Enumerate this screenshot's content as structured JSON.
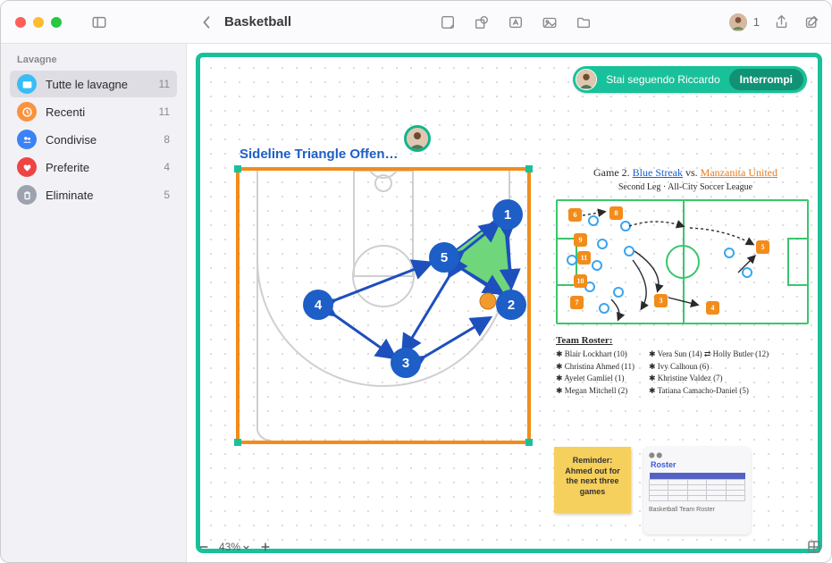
{
  "header": {
    "title": "Basketball",
    "participant_count": "1"
  },
  "sidebar": {
    "section": "Lavagne",
    "items": [
      {
        "label": "Tutte le lavagne",
        "count": "11",
        "icon": "folder",
        "sel": true
      },
      {
        "label": "Recenti",
        "count": "11",
        "icon": "clock",
        "sel": false
      },
      {
        "label": "Condivise",
        "count": "8",
        "icon": "shared",
        "sel": false
      },
      {
        "label": "Preferite",
        "count": "4",
        "icon": "heart",
        "sel": false
      },
      {
        "label": "Eliminate",
        "count": "5",
        "icon": "trash",
        "sel": false
      }
    ]
  },
  "follow_pill": {
    "text": "Stai seguendo Riccardo",
    "stop_label": "Interrompi"
  },
  "play": {
    "title": "Sideline Triangle Offen…",
    "players": [
      "1",
      "2",
      "3",
      "4",
      "5"
    ]
  },
  "game": {
    "heading_prefix": "Game 2.",
    "team1": "Blue Streak",
    "vs": "vs.",
    "team2": "Manzanita United",
    "subtitle": "Second Leg · All-City Soccer League",
    "orange_chips": [
      "6",
      "8",
      "9",
      "11",
      "10",
      "7",
      "3",
      "4",
      "5"
    ]
  },
  "roster": {
    "title": "Team Roster:",
    "left": [
      "✱ Blair Lockhart (10)",
      "✱ Christina Ahmed (11)",
      "✱ Ayelet Gamliel (1)",
      "✱ Megan Mitchell (2)"
    ],
    "right": [
      "✱ Vera Sun (14) ⇄ Holly Butler (12)",
      "✱ Ivy Calhoun (6)",
      "✱ Khristine Valdez (7)",
      "✱ Tatiana Camacho-Daniel (5)"
    ]
  },
  "sticky": {
    "text": "Reminder: Ahmed out for the next three games"
  },
  "file": {
    "title": "Roster",
    "caption": "Basketball Team Roster"
  },
  "zoom": {
    "level": "43%"
  }
}
